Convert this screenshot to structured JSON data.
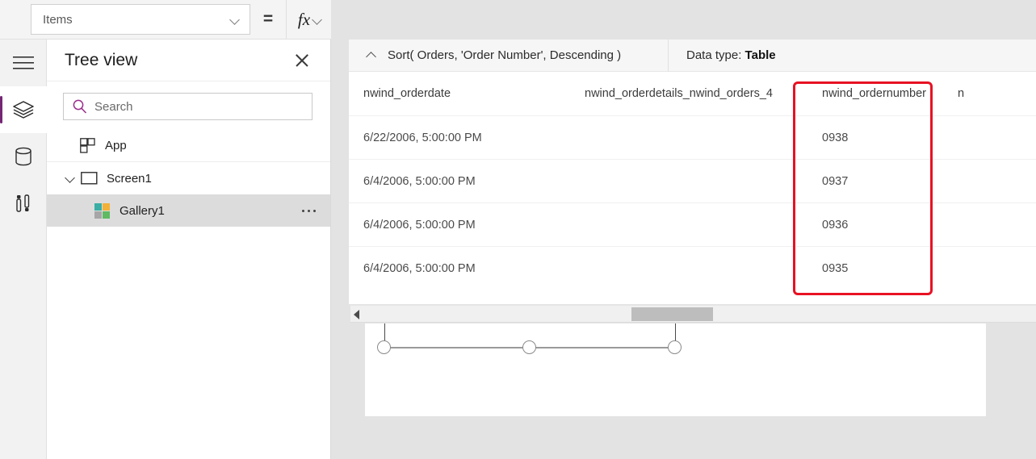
{
  "formula_bar": {
    "property_selected": "Items",
    "equals": "=",
    "fx_label": "fx",
    "formula_tokens": {
      "fn": "Sort",
      "open_paren": "(",
      "arg1": " Orders, ",
      "arg2": "'Order Number'",
      "comma": ", ",
      "arg3": "Descending",
      "close_paren": " )"
    }
  },
  "summary": {
    "expression": "Sort( Orders, 'Order Number', Descending )",
    "data_type_label": "Data type:",
    "data_type_value": "Table"
  },
  "left_rail": {
    "items": [
      {
        "name": "menu-icon",
        "label": "Menu"
      },
      {
        "name": "layers-icon",
        "label": "Tree view"
      },
      {
        "name": "database-icon",
        "label": "Data"
      },
      {
        "name": "insert-icon",
        "label": "Insert"
      }
    ],
    "accent_color": "#742774"
  },
  "tree_view": {
    "title": "Tree view",
    "close_label": "Close",
    "search_placeholder": "Search",
    "items": [
      {
        "label": "App",
        "icon": "app-icon",
        "indent": 0,
        "selected": false
      },
      {
        "label": "Screen1",
        "icon": "screen-icon",
        "indent": 0,
        "selected": false,
        "expanded": true
      },
      {
        "label": "Gallery1",
        "icon": "gallery-icon",
        "indent": 1,
        "selected": true,
        "has_menu": true
      }
    ],
    "gallery_icon_colors": [
      "#3aaea5",
      "#f2b138",
      "#a6a6a6",
      "#5fba62"
    ]
  },
  "data_table": {
    "columns": [
      "nwind_orderdate",
      "nwind_orderdetails_nwind_orders_4",
      "nwind_ordernumber",
      "n"
    ],
    "rows": [
      {
        "nwind_orderdate": "6/22/2006, 5:00:00 PM",
        "nwind_orderdetails_nwind_orders_4": "",
        "nwind_ordernumber": "0938",
        "col4": ""
      },
      {
        "nwind_orderdate": "6/4/2006, 5:00:00 PM",
        "nwind_orderdetails_nwind_orders_4": "",
        "nwind_ordernumber": "0937",
        "col4": ""
      },
      {
        "nwind_orderdate": "6/4/2006, 5:00:00 PM",
        "nwind_orderdetails_nwind_orders_4": "",
        "nwind_ordernumber": "0936",
        "col4": ""
      },
      {
        "nwind_orderdate": "6/4/2006, 5:00:00 PM",
        "nwind_orderdetails_nwind_orders_4": "",
        "nwind_ordernumber": "0935",
        "col4": ""
      }
    ],
    "highlight_column": "nwind_ordernumber",
    "highlight_color": "#e81123"
  },
  "scrollbar": {
    "orientation": "horizontal",
    "left_arrow": "left-arrow-icon"
  }
}
